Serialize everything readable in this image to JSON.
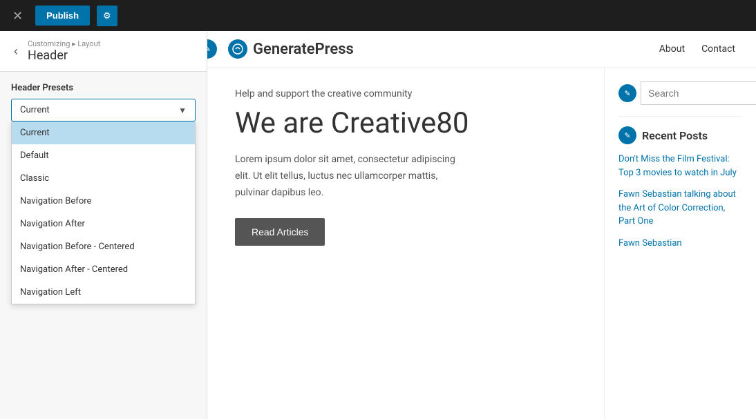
{
  "topbar": {
    "close_label": "✕",
    "publish_label": "Publish",
    "settings_label": "⚙"
  },
  "sidebar": {
    "back_label": "‹",
    "breadcrumb": "Customizing ▸ Layout",
    "page_title": "Header",
    "header_presets_label": "Header Presets",
    "current_value": "Current",
    "chevron": "▼",
    "dropdown_items": [
      {
        "label": "Current",
        "active": true
      },
      {
        "label": "Default",
        "active": false
      },
      {
        "label": "Classic",
        "active": false
      },
      {
        "label": "Navigation Before",
        "active": false
      },
      {
        "label": "Navigation After",
        "active": false
      },
      {
        "label": "Navigation Before - Centered",
        "active": false
      },
      {
        "label": "Navigation After - Centered",
        "active": false
      },
      {
        "label": "Navigation Left",
        "active": false
      }
    ]
  },
  "preview": {
    "site_title": "GeneratePress",
    "gp_icon_char": "✎",
    "nav_links": [
      "About",
      "Contact"
    ],
    "hero_tagline": "Help and support the creative community",
    "hero_title": "We are Creative80",
    "hero_body": "Lorem ipsum dolor sit amet, consectetur adipiscing elit. Ut elit tellus, luctus nec ullamcorper mattis, pulvinar dapibus leo.",
    "read_btn_label": "Read Articles",
    "search_placeholder": "Search",
    "search_btn_label": "🔍",
    "recent_posts_title": "Recent Posts",
    "recent_posts": [
      "Don't Miss the Film Festival: Top 3 movies to watch in July",
      "Fawn Sebastian talking about the Art of Color Correction, Part One",
      "Fawn Sebastian"
    ]
  }
}
